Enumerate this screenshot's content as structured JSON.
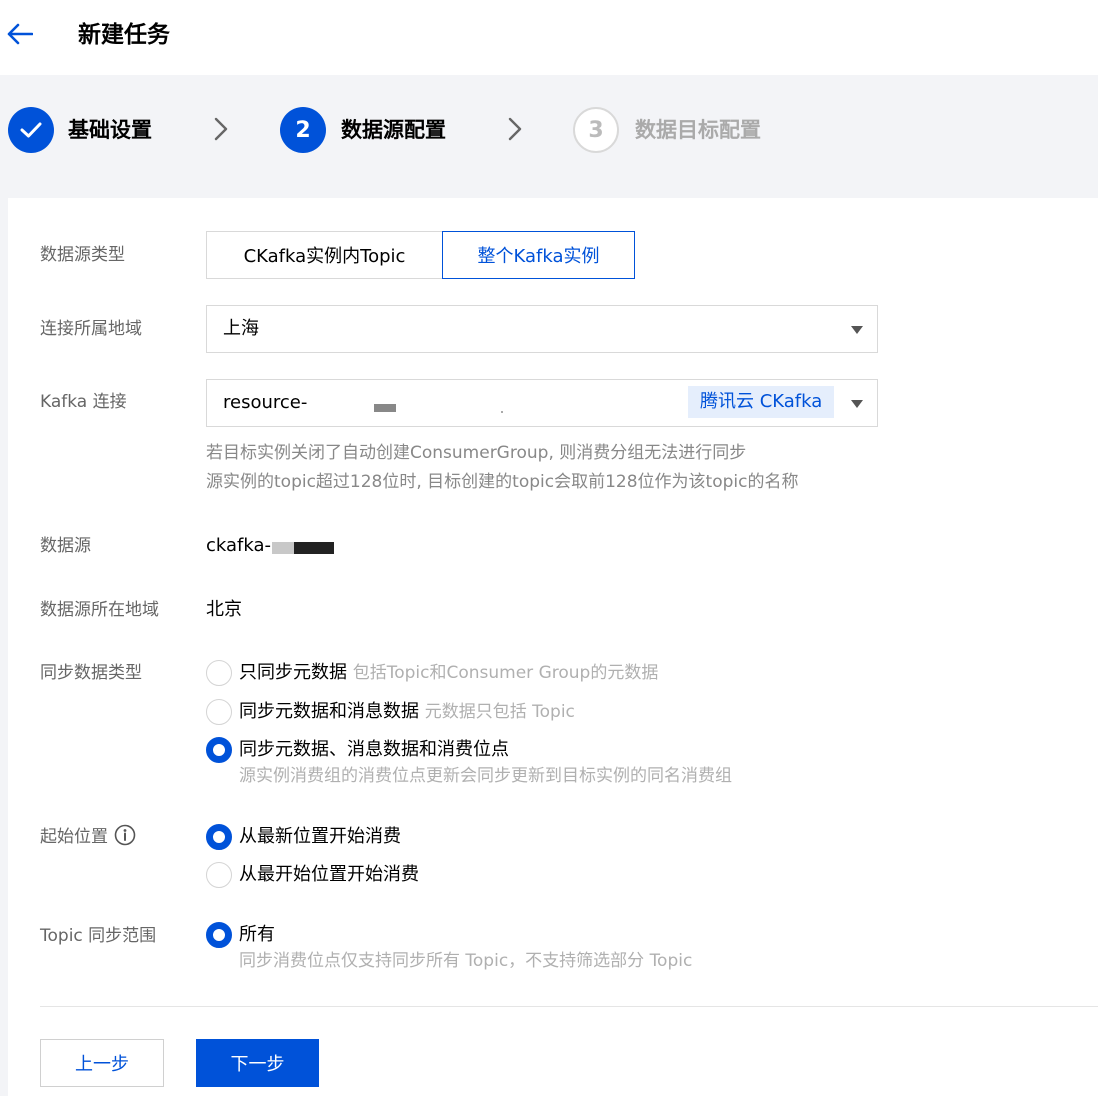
{
  "header": {
    "title": "新建任务",
    "back_icon": "arrow-left-icon"
  },
  "steps": [
    {
      "label": "基础设置",
      "number": "",
      "state": "done"
    },
    {
      "label": "数据源配置",
      "number": "2",
      "state": "active"
    },
    {
      "label": "数据目标配置",
      "number": "3",
      "state": "pending"
    }
  ],
  "colors": {
    "primary": "#0052d9",
    "muted": "#b0b0b0"
  },
  "form": {
    "source_type": {
      "label": "数据源类型",
      "options": [
        "CKafka实例内Topic",
        "整个Kafka实例"
      ],
      "selected": "整个Kafka实例"
    },
    "region": {
      "label": "连接所属地域",
      "value": "上海"
    },
    "kafka_conn": {
      "label": "Kafka 连接",
      "value": "resource-",
      "tag": "腾讯云 CKafka",
      "hints": [
        "若目标实例关闭了自动创建ConsumerGroup, 则消费分组无法进行同步",
        "源实例的topic超过128位时, 目标创建的topic会取前128位作为该topic的名称"
      ]
    },
    "datasource": {
      "label": "数据源",
      "value": "ckafka-"
    },
    "datasource_region": {
      "label": "数据源所在地域",
      "value": "北京"
    },
    "sync_type": {
      "label": "同步数据类型",
      "options": [
        {
          "text": "只同步元数据",
          "sub": "包括Topic和Consumer Group的元数据",
          "checked": false
        },
        {
          "text": "同步元数据和消息数据",
          "sub": "元数据只包括 Topic",
          "checked": false
        },
        {
          "text": "同步元数据、消息数据和消费位点",
          "desc": "源实例消费组的消费位点更新会同步更新到目标实例的同名消费组",
          "checked": true
        }
      ]
    },
    "start_pos": {
      "label": "起始位置",
      "info_icon": "info-icon",
      "options": [
        {
          "text": "从最新位置开始消费",
          "checked": true
        },
        {
          "text": "从最开始位置开始消费",
          "checked": false
        }
      ]
    },
    "topic_range": {
      "label": "Topic 同步范围",
      "option": {
        "text": "所有",
        "checked": true
      },
      "desc": "同步消费位点仅支持同步所有 Topic，不支持筛选部分 Topic"
    }
  },
  "footer": {
    "prev": "上一步",
    "next": "下一步"
  }
}
